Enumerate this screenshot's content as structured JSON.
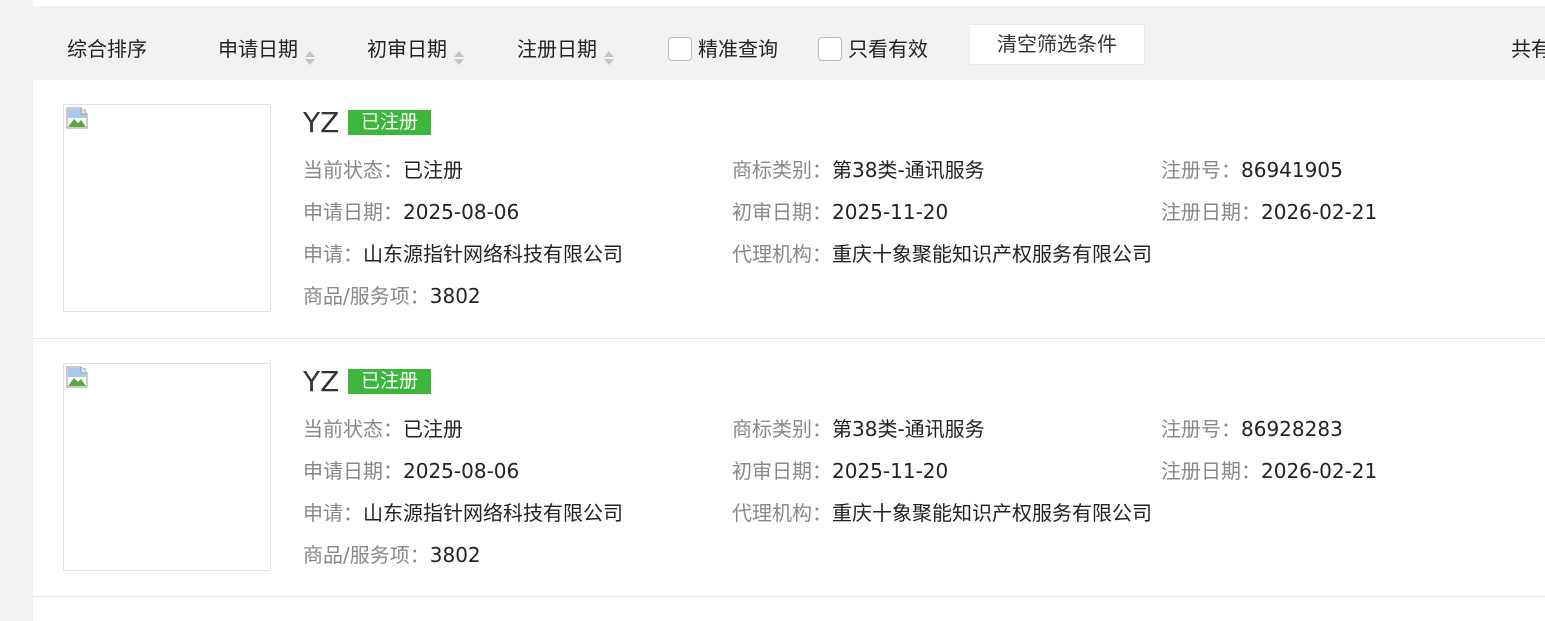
{
  "toolbar": {
    "sorts": [
      {
        "label": "综合排序"
      },
      {
        "label": "申请日期"
      },
      {
        "label": "初审日期"
      },
      {
        "label": "注册日期"
      }
    ],
    "filters": {
      "exact_query": "精准查询",
      "only_valid": "只看有效"
    },
    "clear_label": "清空筛选条件",
    "total_text": "共有"
  },
  "labels": {
    "status": "当前状态：",
    "category": "商标类别：",
    "reg_no": "注册号：",
    "apply_date": "申请日期：",
    "prelim_date": "初审日期：",
    "reg_date": "注册日期：",
    "applicant": "申请：",
    "agency": "代理机构：",
    "goods": "商品/服务项："
  },
  "results": [
    {
      "name": "YZ",
      "badge": "已注册",
      "status": "已注册",
      "category": "第38类-通讯服务",
      "reg_no": "86941905",
      "apply_date": "2025-08-06",
      "prelim_date": "2025-11-20",
      "reg_date": "2026-02-21",
      "applicant": "山东源指针网络科技有限公司",
      "agency": "重庆十象聚能知识产权服务有限公司",
      "goods": "3802"
    },
    {
      "name": "YZ",
      "badge": "已注册",
      "status": "已注册",
      "category": "第38类-通讯服务",
      "reg_no": "86928283",
      "apply_date": "2025-08-06",
      "prelim_date": "2025-11-20",
      "reg_date": "2026-02-21",
      "applicant": "山东源指针网络科技有限公司",
      "agency": "重庆十象聚能知识产权服务有限公司",
      "goods": "3802"
    }
  ],
  "colors": {
    "badge_bg": "#3cb73c",
    "label": "#888888",
    "value": "#222222"
  },
  "icons": {
    "sort": "sort-arrows-icon",
    "image": "broken-image-icon",
    "checkbox": "checkbox-icon"
  }
}
